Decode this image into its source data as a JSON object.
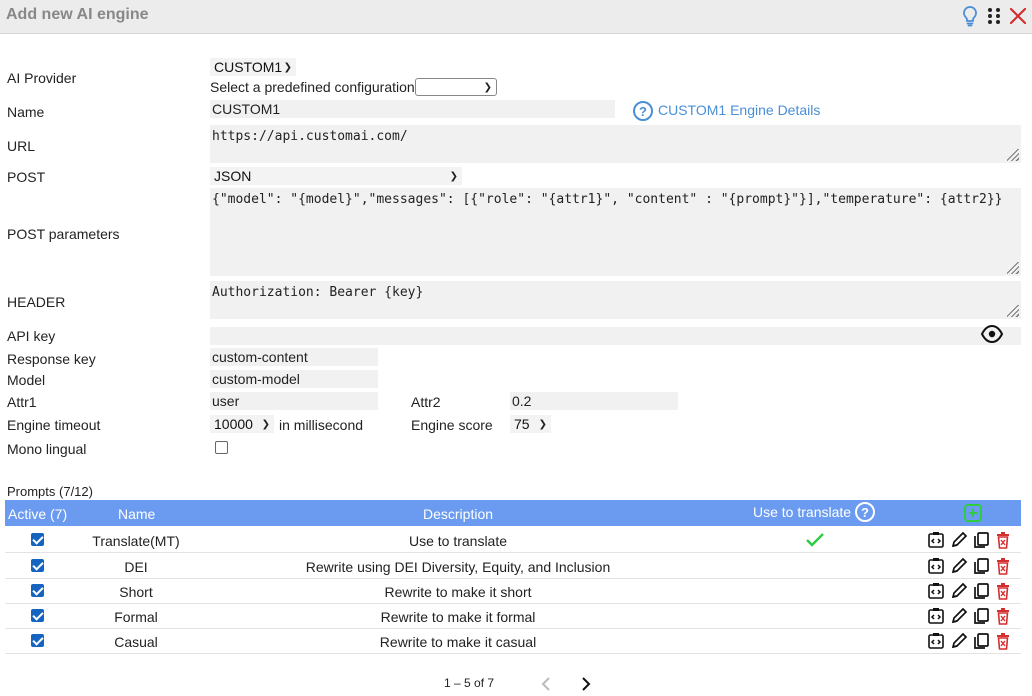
{
  "header": {
    "title": "Add new AI engine"
  },
  "form": {
    "ai_provider_label": "AI Provider",
    "ai_provider_value": "CUSTOM1",
    "predefined_label": "Select a predefined configuration",
    "predefined_value": "",
    "name_label": "Name",
    "name_value": "CUSTOM1",
    "details_link": "CUSTOM1 Engine Details",
    "url_label": "URL",
    "url_value": "https://api.customai.com/",
    "post_label": "POST",
    "post_value": "JSON",
    "post_params_label": "POST parameters",
    "post_params_value": "{\"model\": \"{model}\",\"messages\": [{\"role\": \"{attr1}\", \"content\" :  \"{prompt}\"}],\"temperature\": {attr2}}",
    "header_label": "HEADER",
    "header_value": "Authorization: Bearer {key}",
    "api_key_label": "API key",
    "api_key_value": "",
    "response_key_label": "Response key",
    "response_key_value": "custom-content",
    "model_label": "Model",
    "model_value": "custom-model",
    "attr1_label": "Attr1",
    "attr1_value": "user",
    "attr2_label": "Attr2",
    "attr2_value": "0.2",
    "timeout_label": "Engine timeout",
    "timeout_value": "10000",
    "timeout_unit": "in millisecond",
    "score_label": "Engine score",
    "score_value": "75",
    "mono_label": "Mono lingual",
    "mono_checked": false
  },
  "prompts": {
    "section_title": "Prompts (7/12)",
    "columns": {
      "active": "Active (7)",
      "name": "Name",
      "description": "Description",
      "use": "Use to translate"
    },
    "rows": [
      {
        "active": true,
        "name": "Translate(MT)",
        "description": "Use to translate",
        "use": true
      },
      {
        "active": true,
        "name": "DEI",
        "description": "Rewrite using DEI Diversity, Equity, and Inclusion",
        "use": false
      },
      {
        "active": true,
        "name": "Short",
        "description": "Rewrite to make it short",
        "use": false
      },
      {
        "active": true,
        "name": "Formal",
        "description": "Rewrite to make it formal",
        "use": false
      },
      {
        "active": true,
        "name": "Casual",
        "description": "Rewrite to make it casual",
        "use": false
      }
    ]
  },
  "pagination": {
    "range": "1 – 5 of 7"
  },
  "colors": {
    "header_blue": "#6b9bf0",
    "link_blue": "#4a8fd6",
    "delete_red": "#d32f2f",
    "check_green": "#2ecc40",
    "close_red": "#d32f2f"
  }
}
